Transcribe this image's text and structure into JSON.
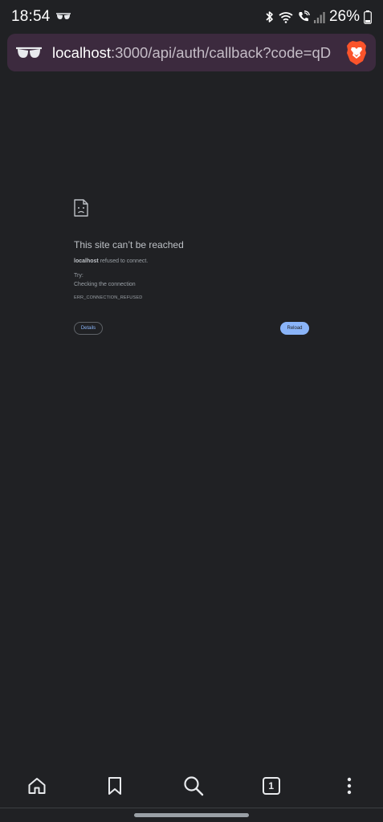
{
  "status_bar": {
    "time": "18:54",
    "battery": "26%",
    "icons": [
      "incognito-icon",
      "bluetooth-icon",
      "wifi-icon",
      "wifi-calling-icon",
      "signal-icon",
      "battery-icon"
    ]
  },
  "url_bar": {
    "host": "localhost",
    "path": ":3000/api/auth/callback?code=qD"
  },
  "error_page": {
    "title": "This site can’t be reached",
    "host": "localhost",
    "message": "refused to connect.",
    "try_label": "Try:",
    "suggestion": "Checking the connection",
    "code": "ERR_CONNECTION_REFUSED",
    "details_label": "Details",
    "reload_label": "Reload"
  },
  "toolbar": {
    "tab_count": "1",
    "icons": [
      "home-icon",
      "bookmark-icon",
      "search-icon",
      "tab-switcher-icon",
      "more-menu-icon"
    ]
  },
  "colors": {
    "background": "#202124",
    "url_bar": "#3c2a3e",
    "accent": "#8ab4f8",
    "brave": "#fb542b"
  }
}
